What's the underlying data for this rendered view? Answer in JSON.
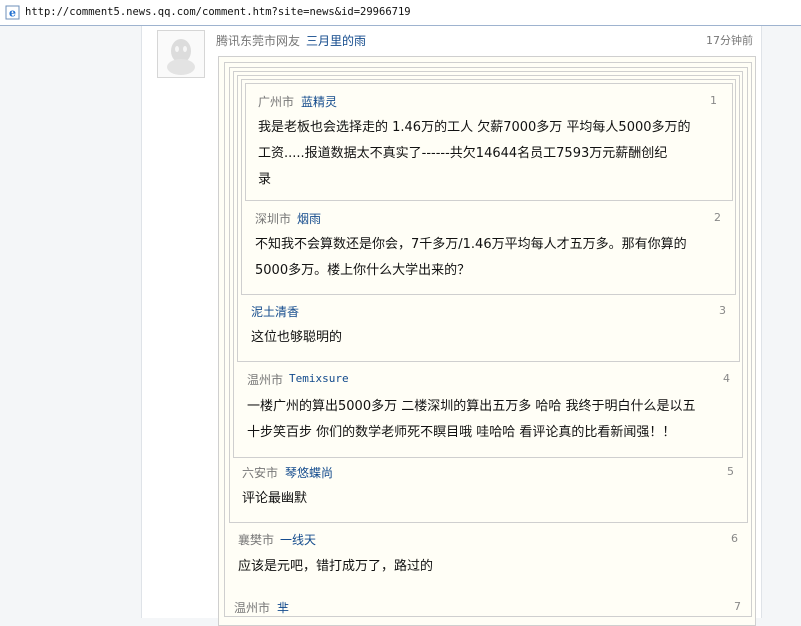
{
  "address": {
    "url": "http://comment5.news.qq.com/comment.htm?site=news&id=29966719"
  },
  "comment": {
    "location": "腾讯东莞市网友",
    "user": "三月里的雨",
    "time": "17分钟前",
    "avatar_icon": "qq-penguin-icon"
  },
  "quotes": [
    {
      "location": "广州市",
      "user": "蓝精灵",
      "floor": "1",
      "lines": [
        "我是老板也会选择走的 1.46万的工人 欠薪7000多万 平均每人5000多万的",
        "工资.....报道数据太不真实了------共欠14644名员工7593万元薪酬创纪",
        "录"
      ]
    },
    {
      "location": "深圳市",
      "user": "烟雨",
      "floor": "2",
      "lines": [
        "不知我不会算数还是你会，7千多万/1.46万平均每人才五万多。那有你算的",
        "5000多万。楼上你什么大学出来的？"
      ]
    },
    {
      "location": "",
      "user": "泥土清香",
      "floor": "3",
      "lines": [
        "这位也够聪明的"
      ]
    },
    {
      "location": "温州市",
      "user": "Temixsure",
      "floor": "4",
      "lines": [
        "一楼广州的算出5000多万 二楼深圳的算出五万多 哈哈 我终于明白什么是以五",
        "十步笑百步 你们的数学老师死不瞑目哦 哇哈哈 看评论真的比看新闻强！！"
      ]
    },
    {
      "location": "六安市",
      "user": "琴悠蝶尚",
      "floor": "5",
      "lines": [
        "评论最幽默"
      ]
    },
    {
      "location": "襄樊市",
      "user": "一线天",
      "floor": "6",
      "lines": [
        "应该是元吧，错打成万了，路过的"
      ]
    },
    {
      "location": "温州市",
      "user": "芈",
      "floor": "7",
      "lines": []
    }
  ]
}
